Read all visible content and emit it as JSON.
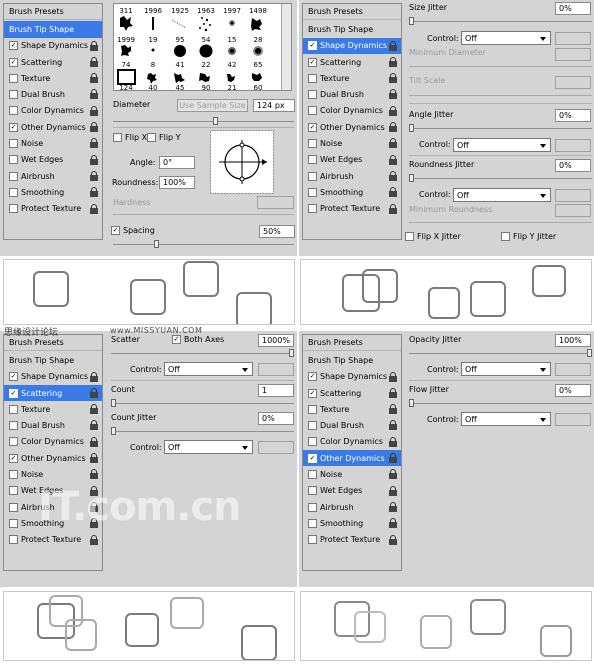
{
  "sidebar_items": {
    "presets": "Brush Presets",
    "tip_shape": "Brush Tip Shape",
    "shape_dynamics": "Shape Dynamics",
    "scattering": "Scattering",
    "texture": "Texture",
    "dual_brush": "Dual Brush",
    "color_dynamics": "Color Dynamics",
    "other_dynamics": "Other Dynamics",
    "noise": "Noise",
    "wet_edges": "Wet Edges",
    "airbrush": "Airbrush",
    "smoothing": "Smoothing",
    "protect_texture": "Protect Texture"
  },
  "checkmark": "✓",
  "brush_tip": {
    "top_sizes": [
      "311",
      "1996",
      "1925",
      "1963",
      "1997",
      "1498"
    ],
    "row1_sizes": [
      "1999",
      "19",
      "95",
      "54",
      "15",
      "28"
    ],
    "row2_sizes": [
      "74",
      "8",
      "41",
      "22",
      "42",
      "65"
    ],
    "row3_sizes": [
      "124",
      "40",
      "45",
      "90",
      "21",
      "60"
    ],
    "diameter_label": "Diameter",
    "use_sample_size": "Use Sample Size",
    "diameter_value": "124 px",
    "flip_x": "Flip X",
    "flip_y": "Flip Y",
    "angle_label": "Angle:",
    "angle_value": "0°",
    "roundness_label": "Roundness:",
    "roundness_value": "100%",
    "hardness_label": "Hardness",
    "spacing_label": "Spacing",
    "spacing_value": "50%"
  },
  "shape_dynamics": {
    "size_jitter_label": "Size Jitter",
    "size_jitter_value": "0%",
    "control_label": "Control:",
    "control_off": "Off",
    "min_diameter_label": "Minimum Diameter",
    "tilt_scale_label": "Tilt Scale",
    "angle_jitter_label": "Angle Jitter",
    "angle_jitter_value": "0%",
    "roundness_jitter_label": "Roundness Jitter",
    "roundness_jitter_value": "0%",
    "min_roundness_label": "Minimum Roundness",
    "flip_x_jitter": "Flip X Jitter",
    "flip_y_jitter": "Flip Y Jitter"
  },
  "scattering": {
    "scatter_label": "Scatter",
    "both_axes": "Both Axes",
    "scatter_value": "1000%",
    "control_label": "Control:",
    "control_off": "Off",
    "count_label": "Count",
    "count_value": "1",
    "count_jitter_label": "Count Jitter",
    "count_jitter_value": "0%"
  },
  "other_dynamics": {
    "opacity_jitter_label": "Opacity Jitter",
    "opacity_jitter_value": "100%",
    "control_label": "Control:",
    "control_off": "Off",
    "flow_jitter_label": "Flow Jitter",
    "flow_jitter_value": "0%"
  },
  "watermarks": {
    "site_text": "思缘设计论坛",
    "site_url": "www.MISSYUAN.COM",
    "logo_text": "IT.com.cn"
  }
}
